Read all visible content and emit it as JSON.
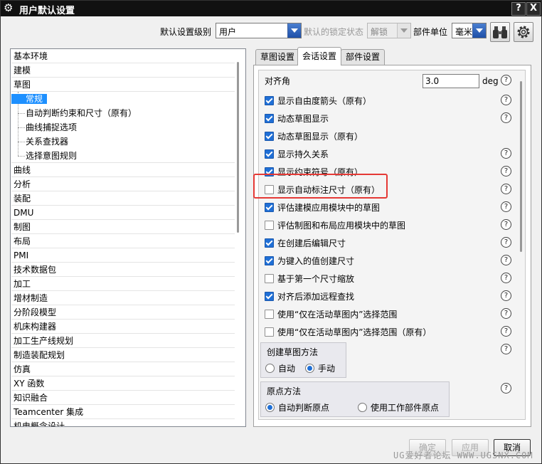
{
  "window": {
    "title": "用户默认设置",
    "help_label": "?",
    "close_label": "X"
  },
  "toolbar": {
    "level_label": "默认设置级别",
    "level_value": "用户",
    "lock_label": "默认的锁定状态",
    "lock_value": "解锁",
    "unit_label": "部件单位",
    "unit_value": "毫米"
  },
  "tree": {
    "items": [
      "基本环境",
      "建模",
      "草图",
      "常规",
      "自动判断约束和尺寸（原有）",
      "曲线捕捉选项",
      "关系查找器",
      "选择意图规则",
      "曲线",
      "分析",
      "装配",
      "DMU",
      "制图",
      "布局",
      "PMI",
      "技术数据包",
      "加工",
      "增材制造",
      "分阶段模型",
      "机床构建器",
      "加工生产线规划",
      "制造装配规划",
      "仿真",
      "XY 函数",
      "知识融合",
      "Teamcenter 集成",
      "机电概念设计"
    ]
  },
  "tabs": [
    "草图设置",
    "会话设置",
    "部件设置"
  ],
  "panel": {
    "snap_label": "对齐角",
    "snap_value": "3.0",
    "snap_unit": "deg",
    "help_glyph": "?",
    "options": [
      {
        "label": "显示自由度箭头（原有）",
        "checked": true
      },
      {
        "label": "动态草图显示",
        "checked": true
      },
      {
        "label": "动态草图显示（原有）",
        "checked": true
      },
      {
        "label": "显示持久关系",
        "checked": true
      },
      {
        "label": "显示约束符号（原有）",
        "checked": true
      },
      {
        "label": "显示自动标注尺寸（原有）",
        "checked": false
      },
      {
        "label": "评估建模应用模块中的草图",
        "checked": true
      },
      {
        "label": "评估制图和布局应用模块中的草图",
        "checked": false
      },
      {
        "label": "在创建后编辑尺寸",
        "checked": true
      },
      {
        "label": "为键入的值创建尺寸",
        "checked": true
      },
      {
        "label": "基于第一个尺寸缩放",
        "checked": false
      },
      {
        "label": "对齐后添加远程查找",
        "checked": true
      },
      {
        "label": "使用“仅在活动草图内”选择范围",
        "checked": false
      },
      {
        "label": "使用“仅在活动草图内”选择范围（原有）",
        "checked": false
      }
    ],
    "create_method": {
      "title": "创建草图方法",
      "auto": "自动",
      "manual": "手动",
      "selected": "manual"
    },
    "origin_method": {
      "title": "原点方法",
      "auto": "自动判断原点",
      "work": "使用工作部件原点",
      "selected": "auto"
    }
  },
  "footer": {
    "ok": "确定",
    "apply": "应用",
    "cancel": "取消"
  },
  "watermark": "UG爱好者论坛 WWW.UGSNX.COM",
  "colors": {
    "highlight": "#e53935",
    "selection": "#1e90ff",
    "check": "#1f6fd6"
  }
}
